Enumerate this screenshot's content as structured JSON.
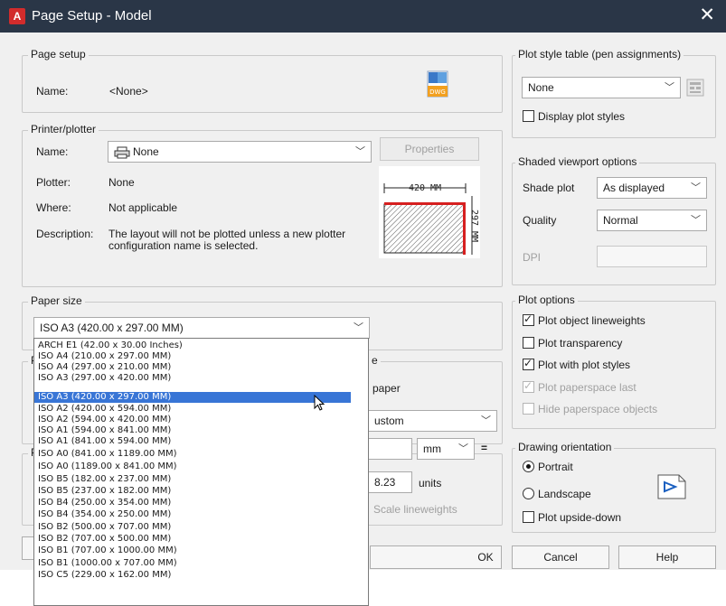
{
  "window": {
    "title": "Page Setup - Model",
    "close_glyph": "✕",
    "app_icon": "A"
  },
  "page_setup": {
    "group_label": "Page setup",
    "name_label": "Name:",
    "name_value": "<None>",
    "dwg_icon_text": "DWG"
  },
  "printer": {
    "group_label": "Printer/plotter",
    "name_label": "Name:",
    "name_value": "None",
    "properties_label": "Properties",
    "plotter_label": "Plotter:",
    "plotter_value": "None",
    "where_label": "Where:",
    "where_value": "Not applicable",
    "description_label": "Description:",
    "description_line1": "The layout will not be plotted unless a new plotter",
    "description_line2": "configuration name is selected.",
    "preview_width_text": "420 MM",
    "preview_height_text": "297 MM"
  },
  "paper_size": {
    "group_label": "Paper size",
    "selected": "ISO A3 (420.00 x 297.00 MM)",
    "options": [
      "ARCH E1 (42.00 x 30.00 Inches)",
      "ISO A4 (210.00 x 297.00 MM)",
      "ISO A4 (297.00 x 210.00 MM)",
      "ISO A3 (297.00 x 420.00 MM)",
      "ISO A3 (420.00 x 297.00 MM)",
      "ISO A2 (420.00 x 594.00 MM)",
      "ISO A2 (594.00 x 420.00 MM)",
      "ISO A1 (594.00 x 841.00 MM)",
      "ISO A1 (841.00 x 594.00 MM)",
      "ISO A0 (841.00 x 1189.00 MM)",
      "ISO A0 (1189.00 x 841.00 MM)",
      "ISO B5 (182.00 x 237.00 MM)",
      "ISO B5 (237.00 x 182.00 MM)",
      "ISO B4 (250.00 x 354.00 MM)",
      "ISO B4 (354.00 x 250.00 MM)",
      "ISO B2 (500.00 x 707.00 MM)",
      "ISO B2 (707.00 x 500.00 MM)",
      "ISO B1 (707.00 x 1000.00 MM)",
      "ISO B1 (1000.00 x 707.00 MM)",
      "ISO C5 (229.00 x 162.00 MM)"
    ],
    "highlighted_index": 4
  },
  "partial_behind_list": {
    "group_letter_plot_area": "P",
    "group_letter_plot_offset": "P",
    "scale_label_fragment": "e",
    "paper_fragment": "paper",
    "custom_fragment": "ustom",
    "units_combo_value": "mm",
    "equals": "=",
    "units_value": "8.23",
    "units_label": "units",
    "scale_lineweights": "Scale lineweights"
  },
  "plot_style_table": {
    "group_label": "Plot style table (pen assignments)",
    "value": "None",
    "display_plot_styles": "Display plot styles",
    "display_checked": false
  },
  "shaded_viewport": {
    "group_label": "Shaded viewport options",
    "shade_plot_label": "Shade plot",
    "shade_plot_value": "As displayed",
    "quality_label": "Quality",
    "quality_value": "Normal",
    "dpi_label": "DPI"
  },
  "plot_options": {
    "group_label": "Plot options",
    "items": [
      {
        "label": "Plot object lineweights",
        "checked": true,
        "disabled": false
      },
      {
        "label": "Plot transparency",
        "checked": false,
        "disabled": false
      },
      {
        "label": "Plot with plot styles",
        "checked": true,
        "disabled": false
      },
      {
        "label": "Plot paperspace last",
        "checked": true,
        "disabled": true
      },
      {
        "label": "Hide paperspace objects",
        "checked": false,
        "disabled": true
      }
    ]
  },
  "orientation": {
    "group_label": "Drawing orientation",
    "portrait": "Portrait",
    "landscape": "Landscape",
    "upside_down": "Plot upside-down",
    "selected": "portrait"
  },
  "buttons": {
    "ok": "OK",
    "cancel": "Cancel",
    "help": "Help"
  },
  "colors": {
    "titlebar": "#2a3647",
    "highlight": "#3875d6",
    "dialog": "#f0f0f0",
    "preview_red": "#d62020"
  }
}
